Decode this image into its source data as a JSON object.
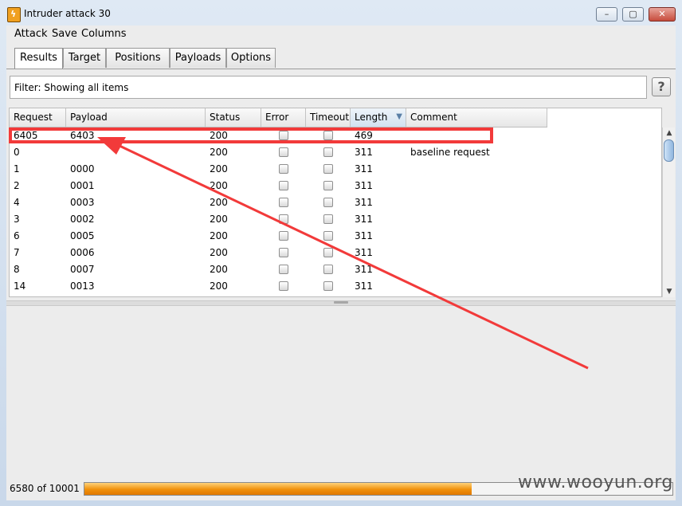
{
  "window": {
    "title": "Intruder attack 30",
    "minimize": "–",
    "maximize": "▢",
    "close": "✕"
  },
  "menu": [
    "Attack",
    "Save",
    "Columns"
  ],
  "tabs": [
    "Results",
    "Target",
    "Positions",
    "Payloads",
    "Options"
  ],
  "active_tab": "Results",
  "filter": {
    "text": "Filter: Showing all items",
    "help": "?"
  },
  "table": {
    "columns": [
      "Request",
      "Payload",
      "Status",
      "Error",
      "Timeout",
      "Length",
      "Comment"
    ],
    "sorted_column": "Length",
    "sort_indicator": "▼",
    "rows": [
      {
        "request": "6405",
        "payload": "6403",
        "status": "200",
        "length": "469",
        "comment": ""
      },
      {
        "request": "0",
        "payload": "",
        "status": "200",
        "length": "311",
        "comment": "baseline request"
      },
      {
        "request": "1",
        "payload": "0000",
        "status": "200",
        "length": "311",
        "comment": ""
      },
      {
        "request": "2",
        "payload": "0001",
        "status": "200",
        "length": "311",
        "comment": ""
      },
      {
        "request": "4",
        "payload": "0003",
        "status": "200",
        "length": "311",
        "comment": ""
      },
      {
        "request": "3",
        "payload": "0002",
        "status": "200",
        "length": "311",
        "comment": ""
      },
      {
        "request": "6",
        "payload": "0005",
        "status": "200",
        "length": "311",
        "comment": ""
      },
      {
        "request": "7",
        "payload": "0006",
        "status": "200",
        "length": "311",
        "comment": ""
      },
      {
        "request": "8",
        "payload": "0007",
        "status": "200",
        "length": "311",
        "comment": ""
      },
      {
        "request": "14",
        "payload": "0013",
        "status": "200",
        "length": "311",
        "comment": ""
      }
    ]
  },
  "status": {
    "text": "6580 of 10001",
    "progress": 0.658
  },
  "watermark": "www.wooyun.org",
  "colors": {
    "annotation": "#f23a3a",
    "progress": "#f0900a"
  }
}
